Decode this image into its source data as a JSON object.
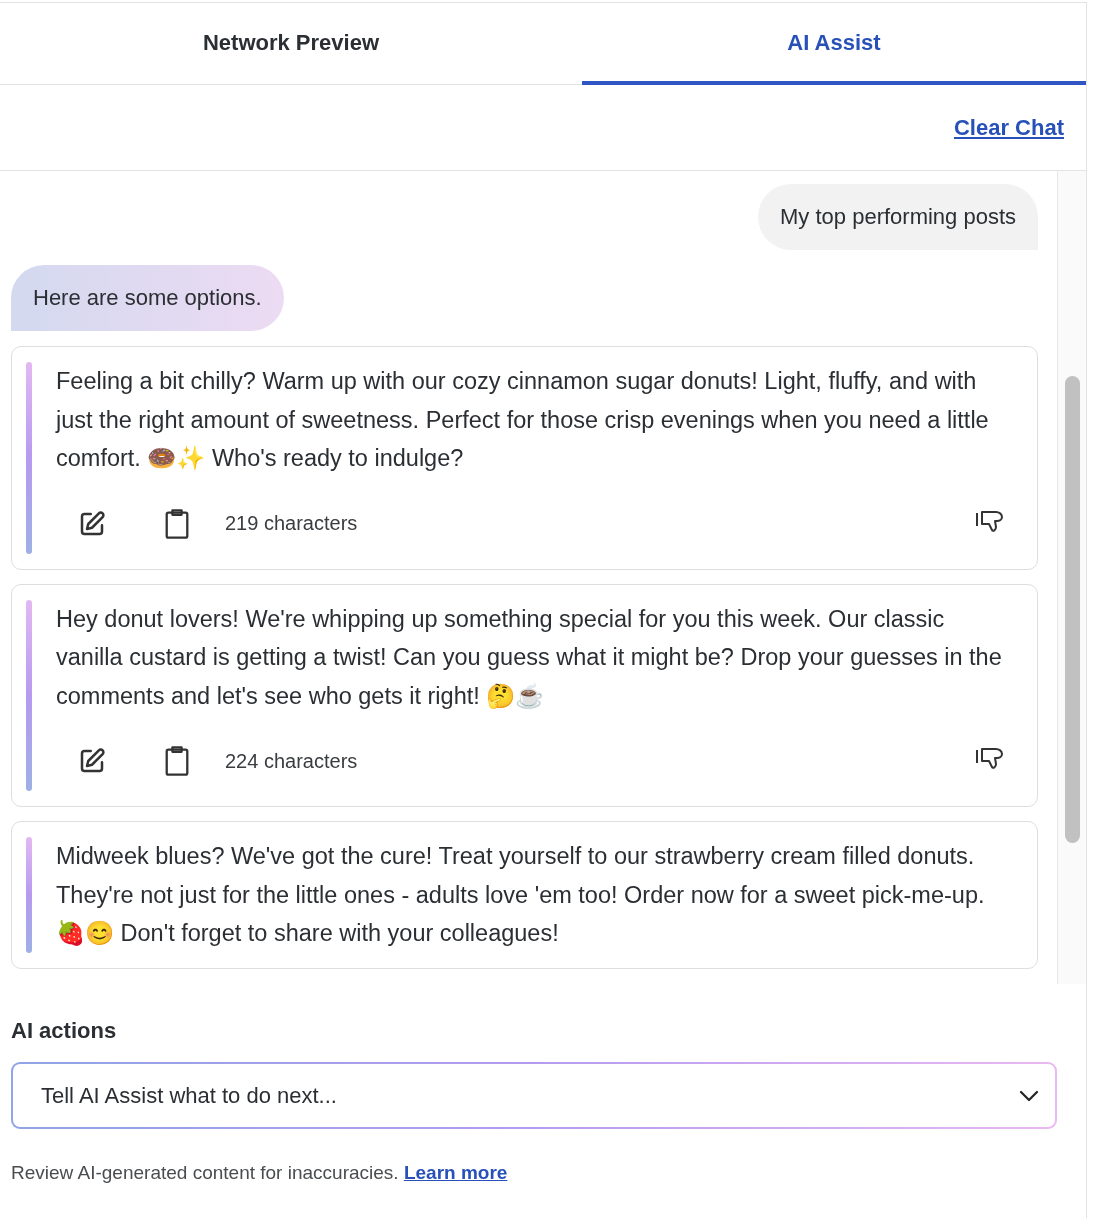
{
  "tabs": [
    {
      "label": "Network Preview",
      "selected": false
    },
    {
      "label": "AI Assist",
      "selected": true
    }
  ],
  "clear_chat": "Clear Chat",
  "messages": [
    {
      "kind": "user",
      "text": "My top performing posts"
    },
    {
      "kind": "assistant",
      "text": "Here are some options."
    }
  ],
  "suggestions": [
    {
      "text": "Feeling a bit chilly? Warm up with our cozy cinnamon sugar donuts! Light, fluffy, and with just the right amount of sweetness. Perfect for those crisp evenings when you need a little comfort. 🍩✨ Who's ready to indulge?",
      "count": "219 characters"
    },
    {
      "text": "Hey donut lovers! We're whipping up something special for you this week. Our classic vanilla custard is getting a twist! Can you guess what it might be? Drop your guesses in the comments and let's see who gets it right! 🤔☕",
      "count": "224 characters"
    },
    {
      "text": "Midweek blues? We've got the cure! Treat yourself to our strawberry cream filled donuts. They're not just for the little ones - adults love 'em too! Order now for a sweet pick-me-up. 🍓😊 Don't forget to share with your colleagues!"
    }
  ],
  "ai_actions": {
    "label": "AI actions",
    "placeholder": "Tell AI Assist what to do next..."
  },
  "disclaimer": {
    "text": "Review AI-generated content for inaccuracies.",
    "link": "Learn more"
  }
}
